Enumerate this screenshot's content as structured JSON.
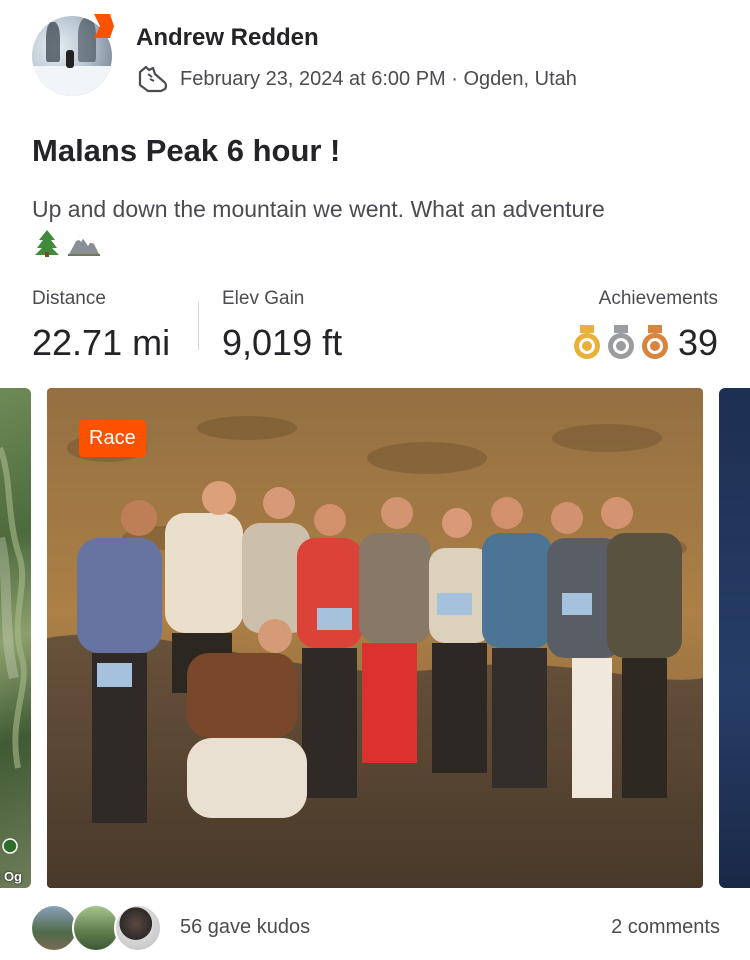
{
  "header": {
    "athlete_name": "Andrew Redden",
    "activity_icon": "run-shoe-icon",
    "meta": "February 23, 2024 at 6:00 PM · Ogden, Utah"
  },
  "activity": {
    "title": "Malans Peak 6 hour !",
    "description": "Up and down the mountain we went.  What an adventure",
    "emojis": [
      "evergreen-tree",
      "snow-capped-mountain"
    ]
  },
  "stats": {
    "distance_label": "Distance",
    "distance_value": "22.71 mi",
    "elev_label": "Elev Gain",
    "elev_value": "9,019 ft",
    "achievements_label": "Achievements",
    "achievements_value": "39",
    "medals": [
      "gold-medal-icon",
      "silver-medal-icon",
      "bronze-medal-icon"
    ]
  },
  "media": {
    "race_tag": "Race",
    "map_label": "t Og"
  },
  "footer": {
    "kudos_text": "56 gave kudos",
    "comments_text": "2 comments"
  },
  "colors": {
    "accent": "#fc5200",
    "text_primary": "#242428",
    "text_secondary": "#4b4b52",
    "gold": "#e8b23a",
    "silver": "#9a9ca0",
    "bronze": "#d9843c"
  }
}
